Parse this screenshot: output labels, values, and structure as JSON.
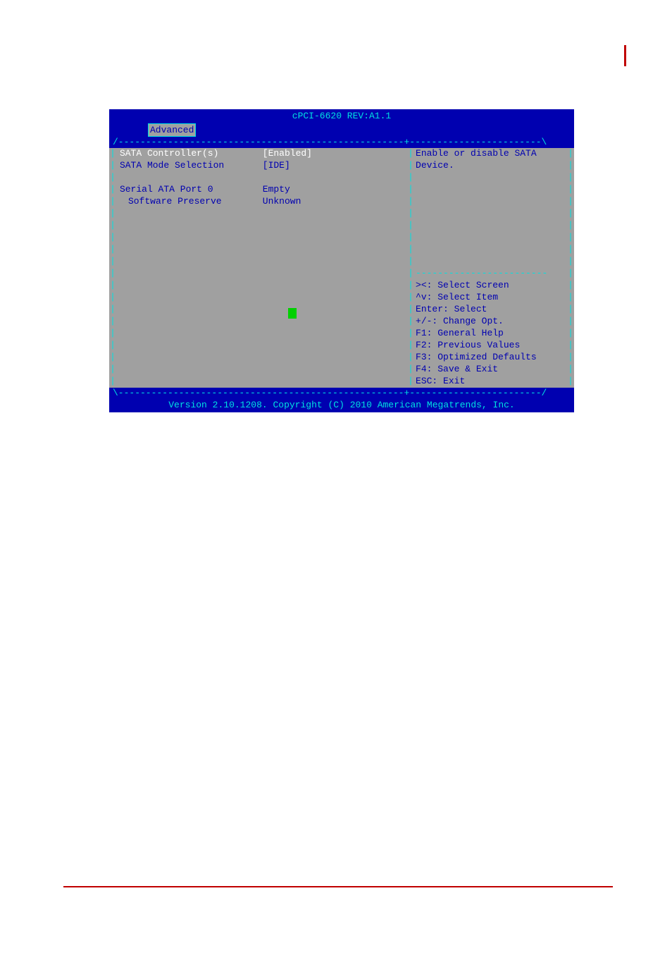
{
  "title": "cPCI-6620 REV:A1.1",
  "tab": "Advanced",
  "settings": {
    "row1": {
      "label": "SATA Controller(s)",
      "value": "[Enabled]"
    },
    "row2": {
      "label": "SATA Mode Selection",
      "value": "[IDE]"
    },
    "row3": {
      "label": "Serial ATA Port 0",
      "value": "Empty"
    },
    "row4": {
      "label": "Software Preserve",
      "value": "Unknown"
    }
  },
  "help": {
    "line1": "Enable or disable SATA",
    "line2": "Device."
  },
  "nav": {
    "l1": "><: Select Screen",
    "l2": "^v: Select Item",
    "l3": "Enter: Select",
    "l4": "+/-: Change Opt.",
    "l5": "F1: General Help",
    "l6": "F2: Previous Values",
    "l7": "F3: Optimized Defaults",
    "l8": "F4: Save & Exit",
    "l9": "ESC: Exit"
  },
  "borders": {
    "top": "/----------------------------------------------------+------------------------\\",
    "help_sep": "------------------------",
    "bottom": "\\----------------------------------------------------+------------------------/"
  },
  "footer": "Version 2.10.1208. Copyright (C) 2010 American Megatrends, Inc."
}
